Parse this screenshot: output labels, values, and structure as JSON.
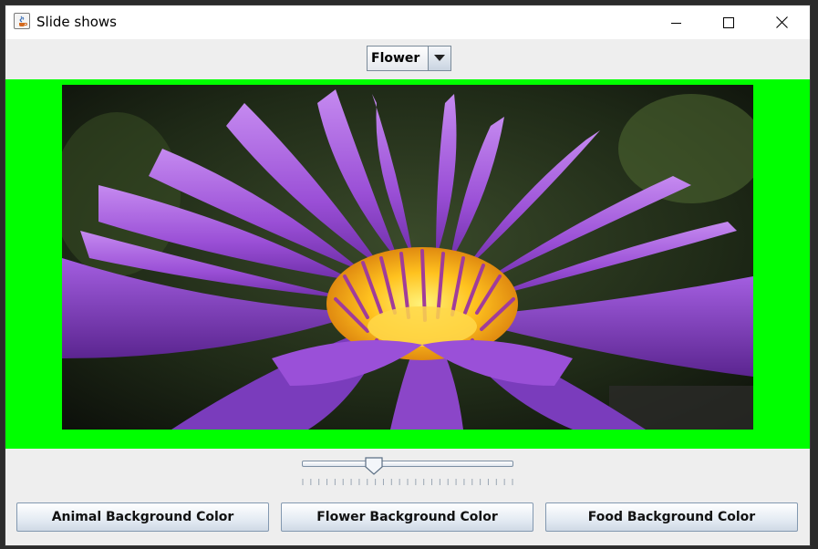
{
  "window": {
    "title": "Slide shows"
  },
  "combo": {
    "selected": "Flower"
  },
  "slide": {
    "subject": "flower",
    "background_color": "#00ff00"
  },
  "slider": {
    "value_fraction": 0.34,
    "tick_count": 27
  },
  "buttons": {
    "animal_label": "Animal Background Color",
    "flower_label": "Flower Background Color",
    "food_label": "Food Background Color"
  },
  "icons": [
    "java-app-icon",
    "minimize-icon",
    "maximize-icon",
    "close-icon",
    "chevron-down-icon"
  ]
}
